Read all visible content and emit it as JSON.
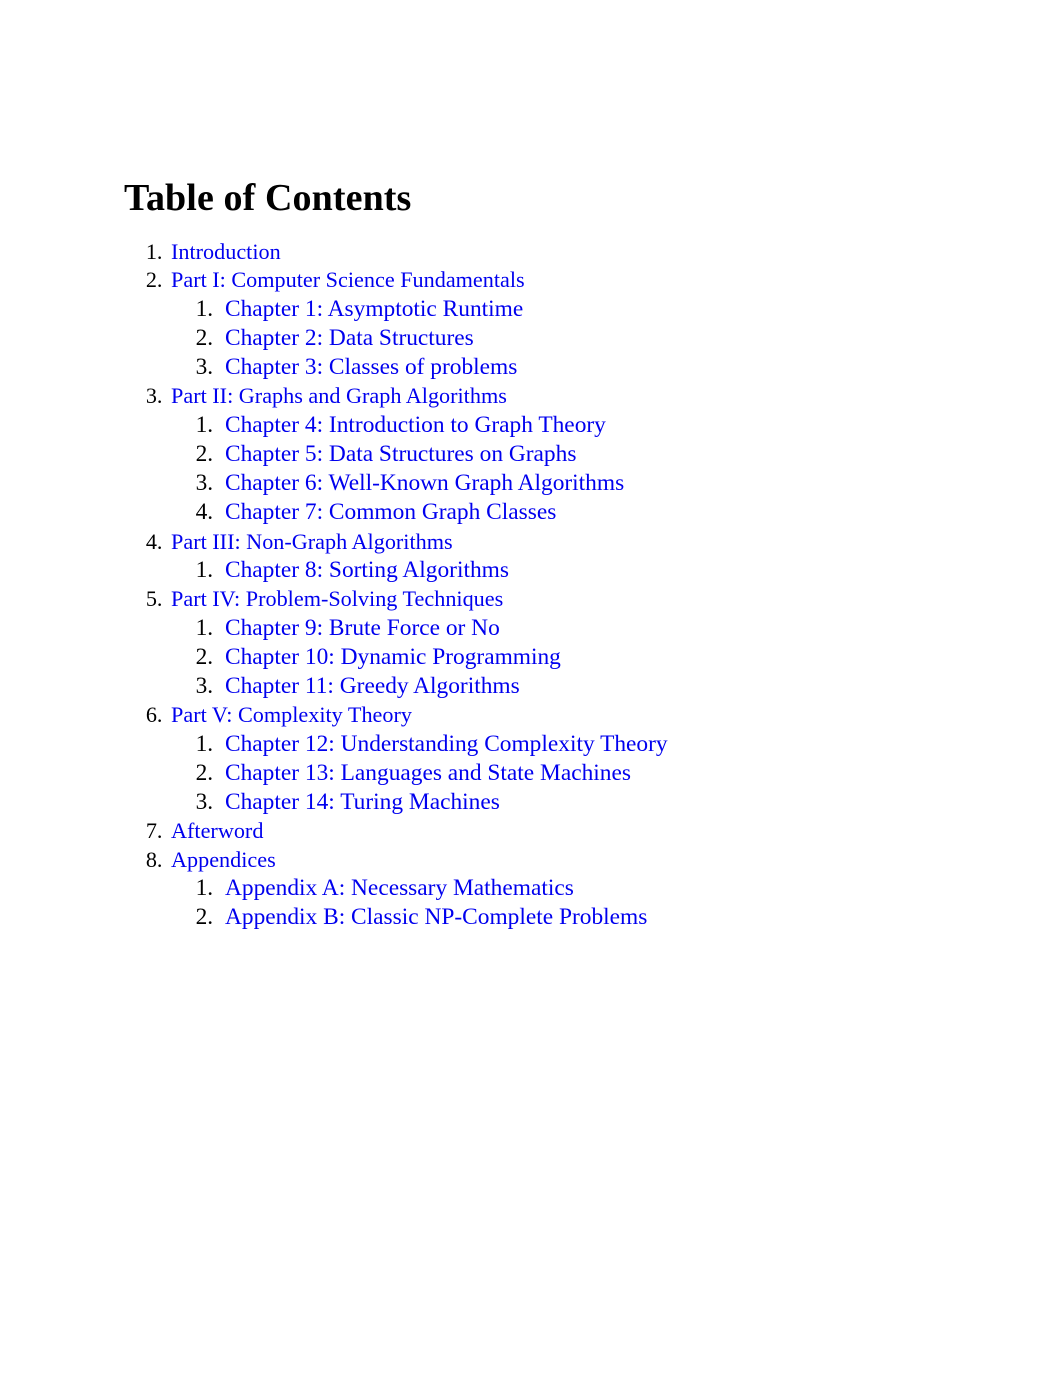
{
  "document": {
    "title": "Table of Contents",
    "link_color": "#0000ee",
    "text_color": "#000000",
    "background_color": "#ffffff"
  },
  "toc": {
    "items": [
      {
        "label": "Introduction",
        "children": []
      },
      {
        "label": "Part I: Computer Science Fundamentals",
        "children": [
          {
            "label": "Chapter 1: Asymptotic Runtime"
          },
          {
            "label": "Chapter 2: Data Structures"
          },
          {
            "label": "Chapter 3: Classes of problems"
          }
        ]
      },
      {
        "label": "Part II: Graphs and Graph Algorithms",
        "children": [
          {
            "label": "Chapter 4: Introduction to Graph Theory"
          },
          {
            "label": "Chapter 5: Data Structures on Graphs"
          },
          {
            "label": "Chapter 6: Well-Known Graph Algorithms"
          },
          {
            "label": "Chapter 7: Common Graph Classes"
          }
        ]
      },
      {
        "label": "Part III: Non-Graph Algorithms",
        "children": [
          {
            "label": "Chapter 8: Sorting Algorithms"
          }
        ]
      },
      {
        "label": "Part IV: Problem-Solving Techniques",
        "children": [
          {
            "label": "Chapter 9: Brute Force or No"
          },
          {
            "label": "Chapter 10: Dynamic Programming"
          },
          {
            "label": "Chapter 11: Greedy Algorithms"
          }
        ]
      },
      {
        "label": "Part V: Complexity Theory",
        "children": [
          {
            "label": "Chapter 12: Understanding Complexity Theory"
          },
          {
            "label": "Chapter 13: Languages and State Machines"
          },
          {
            "label": "Chapter 14: Turing Machines"
          }
        ]
      },
      {
        "label": "Afterword",
        "children": []
      },
      {
        "label": "Appendices",
        "children": [
          {
            "label": "Appendix A: Necessary Mathematics"
          },
          {
            "label": "Appendix B: Classic NP-Complete Problems"
          }
        ]
      }
    ]
  }
}
